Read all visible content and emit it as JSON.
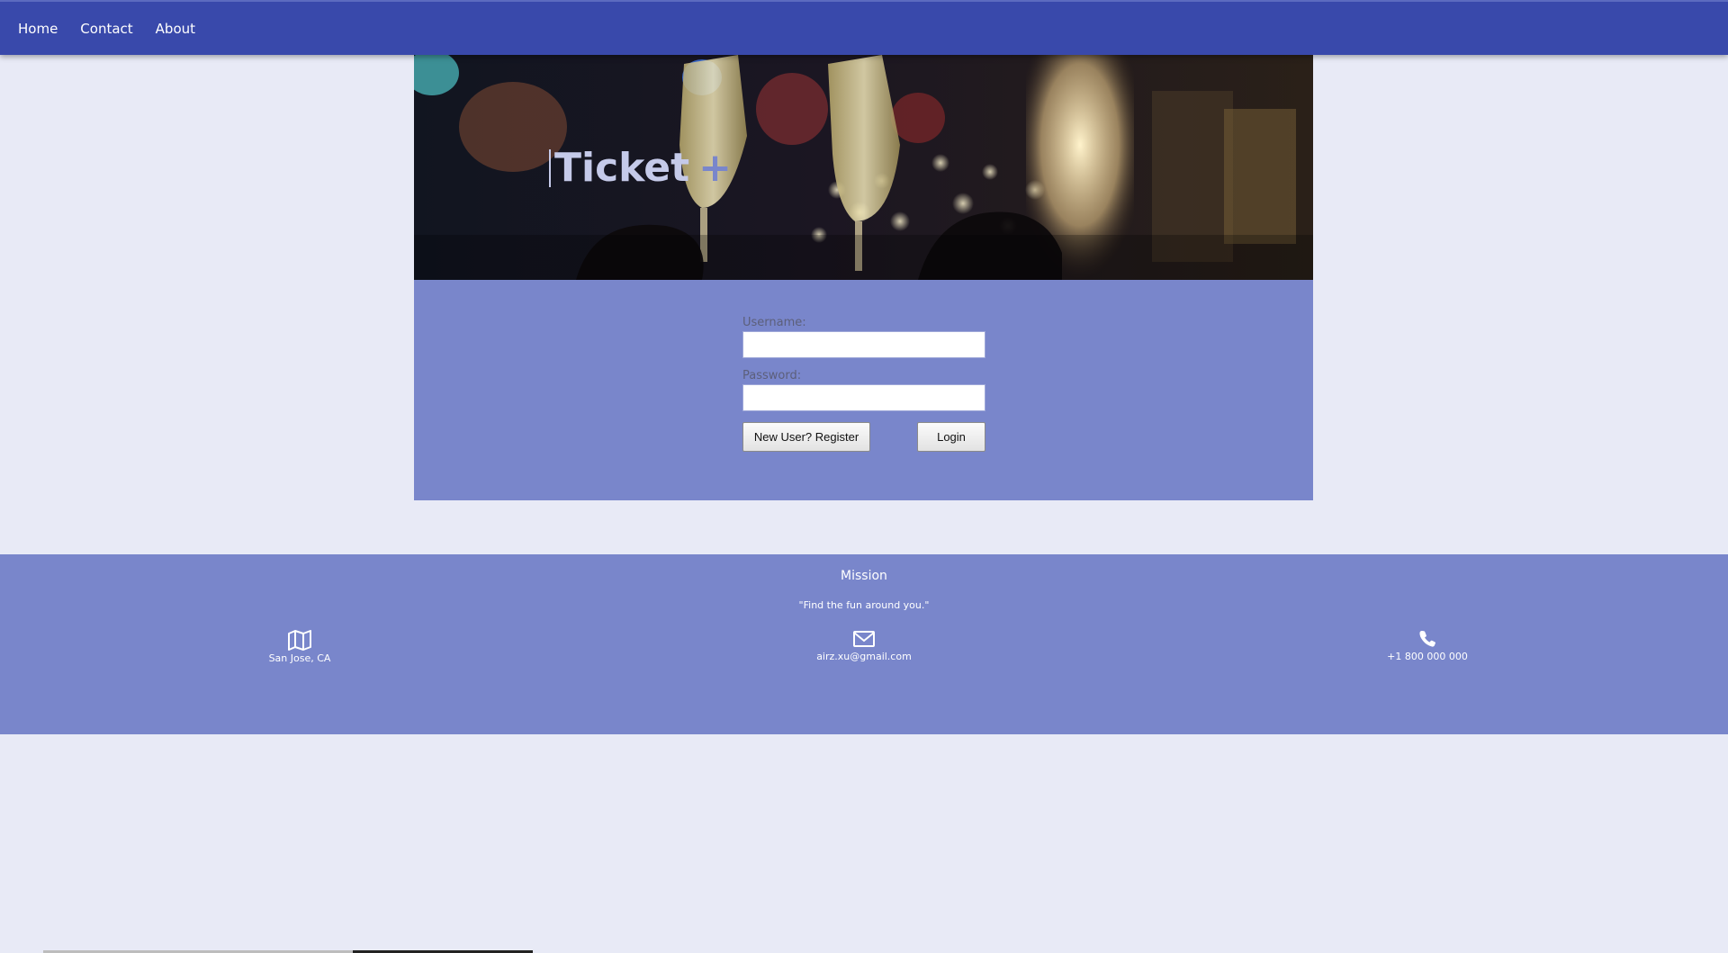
{
  "nav": {
    "items": [
      {
        "label": "Home"
      },
      {
        "label": "Contact"
      },
      {
        "label": "About"
      }
    ]
  },
  "hero": {
    "title": "Ticket",
    "title_suffix": "+"
  },
  "login": {
    "username_label": "Username:",
    "username_value": "",
    "password_label": "Password:",
    "password_value": "",
    "register_label": "New User? Register",
    "login_label": "Login"
  },
  "footer": {
    "mission_title": "Mission",
    "mission_quote": "\"Find the fun around you.\"",
    "location": {
      "icon": "map-icon",
      "text": "San Jose, CA"
    },
    "email": {
      "icon": "envelope-icon",
      "text": "airz.xu@gmail.com"
    },
    "phone": {
      "icon": "phone-icon",
      "text": "+1 800 000 000"
    }
  },
  "colors": {
    "nav_bg": "#3949ab",
    "panel_bg": "#7986cb",
    "page_bg": "#e8eaf6",
    "hero_title": "#c5cae9"
  }
}
